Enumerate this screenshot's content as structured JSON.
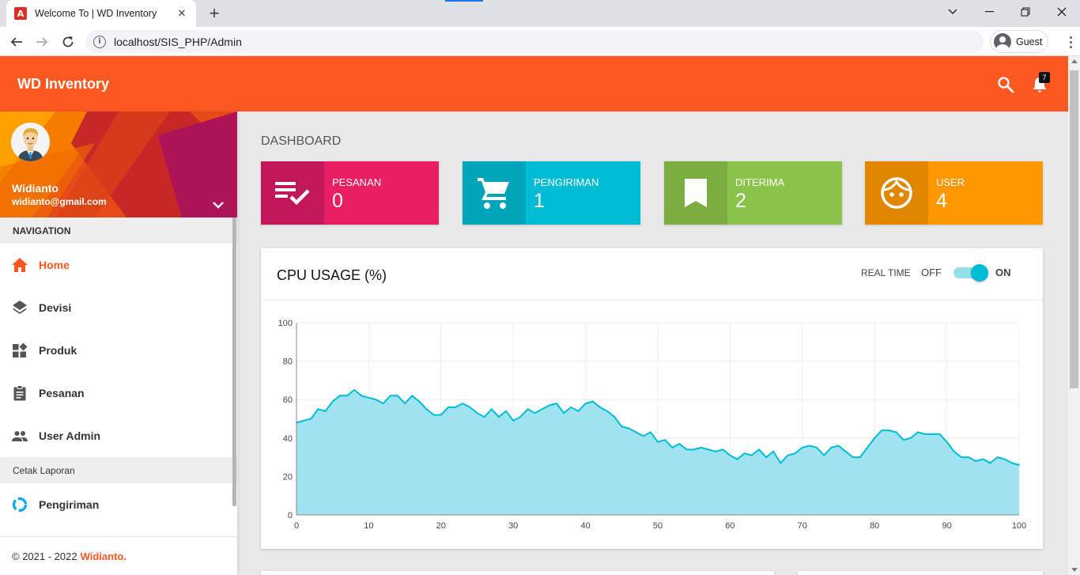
{
  "browser": {
    "tab_title": "Welcome To | WD Inventory",
    "favicon_letter": "A",
    "url": "localhost/SIS_PHP/Admin",
    "profile_label": "Guest"
  },
  "app": {
    "brand": "WD Inventory",
    "notification_count": "7"
  },
  "user": {
    "name": "Widianto",
    "email": "widianto@gmail.com"
  },
  "sidebar": {
    "nav_header": "NAVIGATION",
    "items": [
      {
        "label": "Home",
        "icon": "home-icon",
        "active": true
      },
      {
        "label": "Devisi",
        "icon": "layers-icon"
      },
      {
        "label": "Produk",
        "icon": "widgets-icon"
      },
      {
        "label": "Pesanan",
        "icon": "clipboard-icon"
      },
      {
        "label": "User Admin",
        "icon": "people-icon"
      }
    ],
    "report_header": "Cetak Laporan",
    "report_items": [
      {
        "label": "Pengiriman",
        "icon": "donut-icon"
      }
    ],
    "footer_text": "© 2021 - 2022",
    "footer_author": "Widianto."
  },
  "dashboard": {
    "title": "DASHBOARD",
    "boxes": [
      {
        "label": "PESANAN",
        "value": "0",
        "color": "#e91e63",
        "icon_bg": "#c2185b",
        "icon": "playlist-check-icon"
      },
      {
        "label": "PENGIRIMAN",
        "value": "1",
        "color": "#00bcd4",
        "icon_bg": "#00a5ba",
        "icon": "cart-icon"
      },
      {
        "label": "DITERIMA",
        "value": "2",
        "color": "#8bc34a",
        "icon_bg": "#7cad40",
        "icon": "bookmark-icon"
      },
      {
        "label": "USER",
        "value": "4",
        "color": "#ff9800",
        "icon_bg": "#e08600",
        "icon": "face-icon"
      }
    ]
  },
  "cpu_card": {
    "title": "CPU USAGE (%)",
    "realtime_label": "REAL TIME",
    "off_label": "OFF",
    "on_label": "ON",
    "realtime_on": true
  },
  "chart_data": {
    "type": "area",
    "title": "",
    "xlabel": "",
    "ylabel": "",
    "xlim": [
      0,
      100
    ],
    "ylim": [
      0,
      100
    ],
    "x_ticks": [
      0,
      10,
      20,
      30,
      40,
      50,
      60,
      70,
      80,
      90,
      100
    ],
    "y_ticks": [
      0,
      20,
      40,
      60,
      80,
      100
    ],
    "grid": true,
    "line_color": "#00bcd4",
    "fill_color": "#9ee3ef",
    "series": [
      {
        "x": [
          0,
          1,
          2,
          3,
          4,
          5,
          6,
          7,
          8,
          9,
          10,
          11,
          12,
          13,
          14,
          15,
          16,
          17,
          18,
          19,
          20,
          21,
          22,
          23,
          24,
          25,
          26,
          27,
          28,
          29,
          30,
          31,
          32,
          33,
          34,
          35,
          36,
          37,
          38,
          39,
          40,
          41,
          42,
          43,
          44,
          45,
          46,
          47,
          48,
          49,
          50,
          51,
          52,
          53,
          54,
          55,
          56,
          57,
          58,
          59,
          60,
          61,
          62,
          63,
          64,
          65,
          66,
          67,
          68,
          69,
          70,
          71,
          72,
          73,
          74,
          75,
          76,
          77,
          78,
          79,
          80,
          81,
          82,
          83,
          84,
          85,
          86,
          87,
          88,
          89,
          90,
          91,
          92,
          93,
          94,
          95,
          96,
          97,
          98,
          99,
          100
        ],
        "values": [
          48,
          49,
          50,
          55,
          54,
          59,
          62,
          62,
          65,
          62,
          61,
          60,
          58,
          62,
          62,
          58,
          62,
          59,
          55,
          52,
          52,
          56,
          56,
          58,
          56,
          53,
          51,
          55,
          51,
          54,
          49,
          51,
          55,
          53,
          55,
          57,
          58,
          53,
          56,
          54,
          58,
          59,
          56,
          54,
          51,
          46,
          45,
          43,
          41,
          43,
          38,
          39,
          35,
          37,
          34,
          34,
          35,
          34,
          33,
          34,
          31,
          29,
          32,
          31,
          34,
          30,
          33,
          27,
          31,
          32,
          35,
          36,
          35,
          31,
          35,
          36,
          33,
          30,
          30,
          35,
          40,
          44,
          44,
          43,
          39,
          40,
          43,
          42,
          42,
          42,
          38,
          33,
          30,
          30,
          28,
          29,
          27,
          30,
          29,
          27,
          26
        ]
      }
    ]
  }
}
